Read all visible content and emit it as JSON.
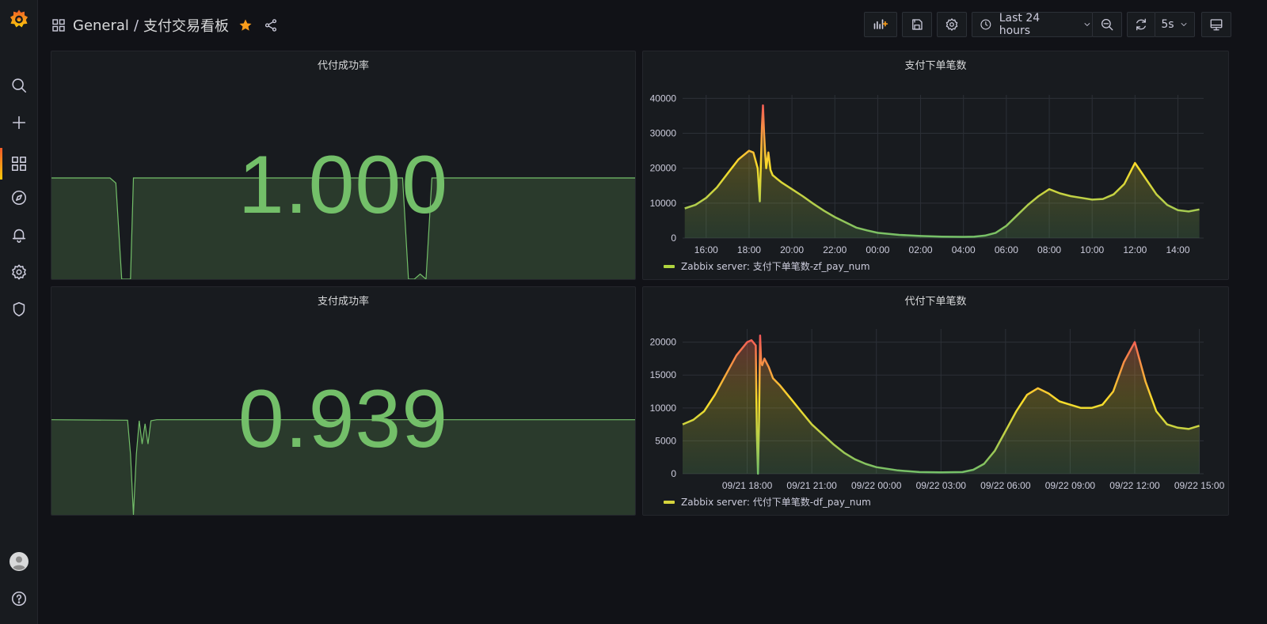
{
  "header": {
    "folder": "General",
    "separator": "/",
    "title": "支付交易看板",
    "time_range": "Last 24 hours",
    "refresh_interval": "5s"
  },
  "sidemenu": {
    "items": [
      "grafana-logo-icon",
      "search-icon",
      "plus-icon",
      "dashboards-icon",
      "explore-icon",
      "alerting-icon",
      "config-icon",
      "shield-icon"
    ]
  },
  "colors": {
    "stat_green": "#73bf69",
    "bg": "#111217",
    "panel_bg": "#181b1f"
  },
  "panels": {
    "df_rate": {
      "title": "代付成功率",
      "value": "1.000"
    },
    "zf_rate": {
      "title": "支付成功率",
      "value": "0.939"
    },
    "zf_num": {
      "title": "支付下单笔数",
      "legend": "Zabbix server: 支付下单笔数-zf_pay_num"
    },
    "df_num": {
      "title": "代付下单笔数",
      "legend": "Zabbix server: 代付下单笔数-df_pay_num"
    }
  },
  "chart_data": [
    {
      "type": "area",
      "title": "代付成功率",
      "note": "sparkline behind stat value",
      "x": [
        0,
        0.1,
        0.11,
        0.12,
        0.13,
        0.135,
        0.14,
        0.6,
        0.61,
        0.62,
        0.63,
        0.64,
        0.65,
        1
      ],
      "values": [
        1,
        1,
        0.95,
        0,
        0,
        0,
        1,
        1,
        0,
        0,
        0.05,
        0,
        1,
        1
      ],
      "ylim": [
        0,
        1
      ]
    },
    {
      "type": "area",
      "title": "支付成功率",
      "note": "sparkline behind stat value",
      "x": [
        0,
        0.13,
        0.135,
        0.14,
        0.145,
        0.15,
        0.155,
        0.16,
        0.165,
        0.17,
        0.18,
        1
      ],
      "values": [
        0.94,
        0.935,
        0.6,
        0,
        0.6,
        0.93,
        0.7,
        0.9,
        0.7,
        0.93,
        0.94,
        0.94
      ],
      "ylim": [
        0,
        1
      ]
    },
    {
      "type": "area",
      "title": "支付下单笔数",
      "xlabel": "",
      "ylabel": "",
      "x_ticks": [
        "16:00",
        "18:00",
        "20:00",
        "22:00",
        "00:00",
        "02:00",
        "04:00",
        "06:00",
        "08:00",
        "10:00",
        "12:00",
        "14:00"
      ],
      "y_ticks": [
        "0",
        "10000",
        "20000",
        "30000",
        "40000"
      ],
      "ylim": [
        0,
        41000
      ],
      "x": [
        15.0,
        15.5,
        16.0,
        16.5,
        17.0,
        17.5,
        18.0,
        18.2,
        18.4,
        18.5,
        18.6,
        18.65,
        18.7,
        18.75,
        18.8,
        18.9,
        19.0,
        19.1,
        19.2,
        19.3,
        19.5,
        20.0,
        20.5,
        21.0,
        21.5,
        22.0,
        22.5,
        23.0,
        23.5,
        24.0,
        25.0,
        26.0,
        27.0,
        28.0,
        28.5,
        29.0,
        29.5,
        30.0,
        30.5,
        31.0,
        31.5,
        32.0,
        32.5,
        33.0,
        33.5,
        34.0,
        34.5,
        35.0,
        35.5,
        36.0,
        36.5,
        37.0,
        37.5,
        38.0,
        38.5,
        39.0
      ],
      "series": [
        {
          "name": "Zabbix server: 支付下单笔数-zf_pay_num",
          "values": [
            8500,
            9500,
            11500,
            14500,
            18500,
            22500,
            25000,
            24500,
            20000,
            10500,
            32000,
            38000,
            30000,
            24000,
            20000,
            24500,
            19500,
            18000,
            17500,
            17000,
            16000,
            14000,
            12000,
            9800,
            7800,
            6000,
            4500,
            3000,
            2200,
            1500,
            900,
            600,
            400,
            350,
            400,
            700,
            1500,
            3500,
            6500,
            9500,
            12000,
            14000,
            12800,
            12000,
            11500,
            11000,
            11200,
            12500,
            15500,
            21500,
            17000,
            12500,
            9500,
            8000,
            7600,
            8200
          ]
        }
      ]
    },
    {
      "type": "area",
      "title": "代付下单笔数",
      "xlabel": "",
      "ylabel": "",
      "x_ticks": [
        "09/21 18:00",
        "09/21 21:00",
        "09/22 00:00",
        "09/22 03:00",
        "09/22 06:00",
        "09/22 09:00",
        "09/22 12:00",
        "09/22 15:00"
      ],
      "y_ticks": [
        "0",
        "5000",
        "10000",
        "15000",
        "20000"
      ],
      "ylim": [
        0,
        22000
      ],
      "x": [
        15.0,
        15.5,
        16.0,
        16.5,
        17.0,
        17.5,
        18.0,
        18.2,
        18.4,
        18.45,
        18.5,
        18.55,
        18.6,
        18.65,
        18.7,
        18.8,
        19.0,
        19.2,
        19.5,
        20.0,
        20.5,
        21.0,
        21.5,
        22.0,
        22.5,
        23.0,
        23.5,
        24.0,
        25.0,
        26.0,
        27.0,
        28.0,
        28.5,
        29.0,
        29.5,
        30.0,
        30.5,
        31.0,
        31.5,
        32.0,
        32.5,
        33.0,
        33.5,
        34.0,
        34.5,
        35.0,
        35.5,
        36.0,
        36.5,
        37.0,
        37.5,
        38.0,
        38.5,
        39.0
      ],
      "series": [
        {
          "name": "Zabbix server: 代付下单笔数-df_pay_num",
          "values": [
            7500,
            8200,
            9500,
            12000,
            15000,
            18000,
            20000,
            20300,
            19500,
            6000,
            0,
            8000,
            21000,
            17000,
            16500,
            17500,
            16200,
            14500,
            13500,
            11500,
            9500,
            7500,
            6000,
            4500,
            3200,
            2200,
            1500,
            1000,
            500,
            250,
            200,
            250,
            600,
            1500,
            3500,
            6500,
            9500,
            12000,
            13000,
            12200,
            11000,
            10500,
            10000,
            10000,
            10500,
            12500,
            17000,
            20000,
            14000,
            9500,
            7500,
            7000,
            6800,
            7300
          ]
        }
      ]
    }
  ]
}
